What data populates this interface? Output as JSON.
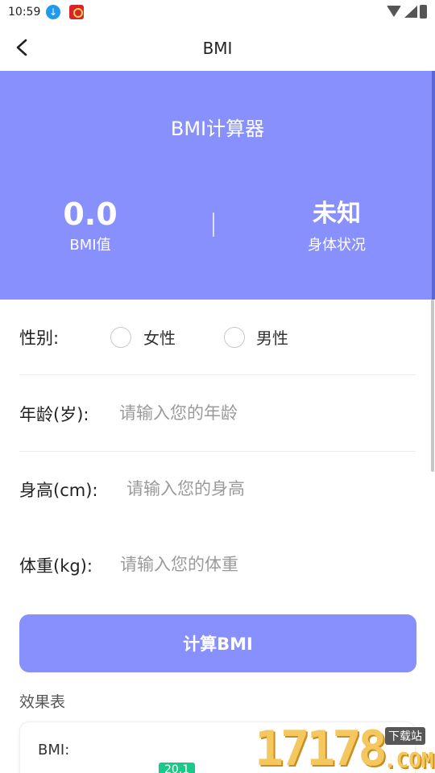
{
  "status_bar": {
    "time": "10:59",
    "icons": [
      "download-icon",
      "app-notification-icon",
      "wifi-icon",
      "signal-icon",
      "battery-icon"
    ]
  },
  "header": {
    "title": "BMI",
    "back_icon": "chevron-left-icon"
  },
  "hero": {
    "title": "BMI计算器",
    "bmi_value": "0.0",
    "bmi_label": "BMI值",
    "status_value": "未知",
    "status_label": "身体状况",
    "background_color": "#8890fd"
  },
  "form": {
    "gender": {
      "label": "性别:",
      "options": [
        {
          "label": "女性",
          "checked": false
        },
        {
          "label": "男性",
          "checked": false
        }
      ]
    },
    "age": {
      "label": "年龄(岁):",
      "placeholder": "请输入您的年龄",
      "value": ""
    },
    "height": {
      "label": "身高(cm):",
      "placeholder": "请输入您的身高",
      "value": ""
    },
    "weight": {
      "label": "体重(kg):",
      "placeholder": "请输入您的体重",
      "value": ""
    }
  },
  "calculate_button": {
    "label": "计算BMI",
    "color": "#8890fd"
  },
  "results": {
    "title": "效果表",
    "bmi_label": "BMI:",
    "badge_value": "20.1",
    "badge_color": "#19c98a"
  },
  "watermark": {
    "digits": "17178",
    "site_tag": "下载站",
    "suffix": ".COM"
  }
}
